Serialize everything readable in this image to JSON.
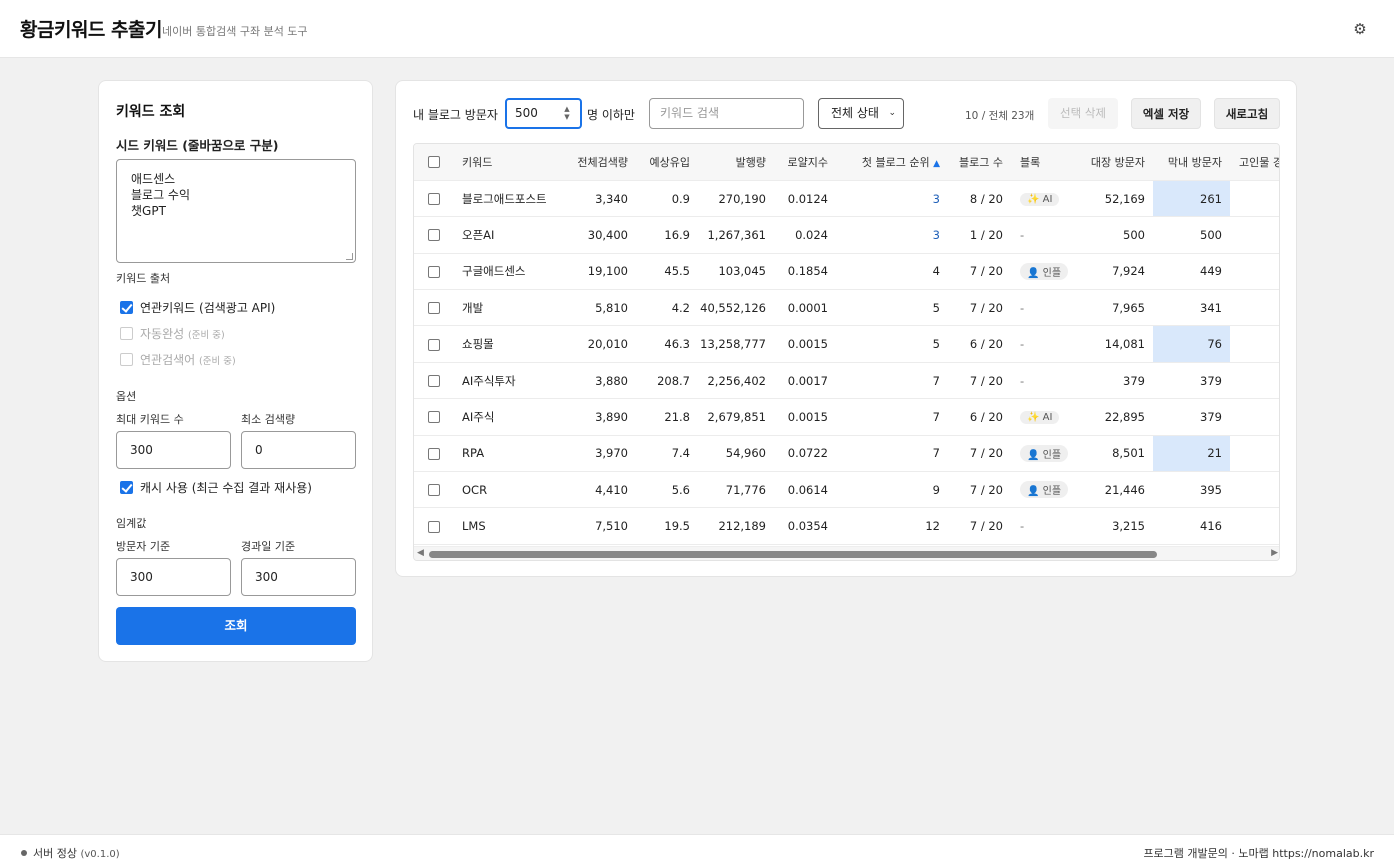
{
  "header": {
    "title": "황금키워드 추출기",
    "subtitle": "네이버 통합검색 구좌 분석 도구",
    "settings_icon": "gear-icon"
  },
  "left": {
    "title": "키워드 조회",
    "seed_label": "시드 키워드 (줄바꿈으로 구분)",
    "seed_lines": [
      "애드센스",
      "블로그 수익",
      "챗GPT"
    ],
    "source_label": "키워드 출처",
    "sources": [
      {
        "label": "연관키워드 (검색광고 API)",
        "note": "",
        "checked": true,
        "disabled": false
      },
      {
        "label": "자동완성",
        "note": "(준비 중)",
        "checked": false,
        "disabled": true
      },
      {
        "label": "연관검색어",
        "note": "(준비 중)",
        "checked": false,
        "disabled": true
      }
    ],
    "options_label": "옵션",
    "max_kw_label": "최대 키워드 수",
    "max_kw_value": "300",
    "min_search_label": "최소 검색량",
    "min_search_value": "0",
    "cache_label": "캐시 사용 (최근 수집 결과 재사용)",
    "cache_checked": true,
    "threshold_label": "임계값",
    "visitor_label": "방문자 기준",
    "visitor_value": "300",
    "days_label": "경과일 기준",
    "days_value": "300",
    "submit_label": "조회"
  },
  "toolbar": {
    "visitor_prefix": "내 블로그 방문자",
    "visitor_value": "500",
    "visitor_suffix": "명 이하만",
    "search_placeholder": "키워드 검색",
    "status_select": "전체 상태",
    "count_text": "10 / 전체 23개",
    "delete_label": "선택 삭제",
    "excel_label": "엑셀 저장",
    "refresh_label": "새로고침"
  },
  "table": {
    "headers": [
      "키워드",
      "전체검색량",
      "예상유입",
      "발행량",
      "로얄지수",
      "첫 블로그 순위",
      "블로그 수",
      "블록",
      "대장 방문자",
      "막내 방문자",
      "고인물 경"
    ],
    "rows": [
      {
        "kw": "블로그애드포스트",
        "total": "3,340",
        "expected": "0.9",
        "published": "270,190",
        "royal": "0.0124",
        "rank": "3",
        "rank_link": true,
        "blogs": "8 / 20",
        "block": "✨ AI",
        "block_badge": true,
        "leader": "52,169",
        "youngest": "261",
        "hl": true
      },
      {
        "kw": "오픈AI",
        "total": "30,400",
        "expected": "16.9",
        "published": "1,267,361",
        "royal": "0.024",
        "rank": "3",
        "rank_link": true,
        "blogs": "1 / 20",
        "block": "-",
        "block_badge": false,
        "leader": "500",
        "youngest": "500",
        "hl": false
      },
      {
        "kw": "구글애드센스",
        "total": "19,100",
        "expected": "45.5",
        "published": "103,045",
        "royal": "0.1854",
        "rank": "4",
        "rank_link": false,
        "blogs": "7 / 20",
        "block": "👤 인플",
        "block_badge": true,
        "leader": "7,924",
        "youngest": "449",
        "hl": false
      },
      {
        "kw": "개발",
        "total": "5,810",
        "expected": "4.2",
        "published": "40,552,126",
        "royal": "0.0001",
        "rank": "5",
        "rank_link": false,
        "blogs": "7 / 20",
        "block": "-",
        "block_badge": false,
        "leader": "7,965",
        "youngest": "341",
        "hl": false
      },
      {
        "kw": "쇼핑몰",
        "total": "20,010",
        "expected": "46.3",
        "published": "13,258,777",
        "royal": "0.0015",
        "rank": "5",
        "rank_link": false,
        "blogs": "6 / 20",
        "block": "-",
        "block_badge": false,
        "leader": "14,081",
        "youngest": "76",
        "hl": true
      },
      {
        "kw": "AI주식투자",
        "total": "3,880",
        "expected": "208.7",
        "published": "2,256,402",
        "royal": "0.0017",
        "rank": "7",
        "rank_link": false,
        "blogs": "7 / 20",
        "block": "-",
        "block_badge": false,
        "leader": "379",
        "youngest": "379",
        "hl": false
      },
      {
        "kw": "AI주식",
        "total": "3,890",
        "expected": "21.8",
        "published": "2,679,851",
        "royal": "0.0015",
        "rank": "7",
        "rank_link": false,
        "blogs": "6 / 20",
        "block": "✨ AI",
        "block_badge": true,
        "leader": "22,895",
        "youngest": "379",
        "hl": false
      },
      {
        "kw": "RPA",
        "total": "3,970",
        "expected": "7.4",
        "published": "54,960",
        "royal": "0.0722",
        "rank": "7",
        "rank_link": false,
        "blogs": "7 / 20",
        "block": "👤 인플",
        "block_badge": true,
        "leader": "8,501",
        "youngest": "21",
        "hl": true
      },
      {
        "kw": "OCR",
        "total": "4,410",
        "expected": "5.6",
        "published": "71,776",
        "royal": "0.0614",
        "rank": "9",
        "rank_link": false,
        "blogs": "7 / 20",
        "block": "👤 인플",
        "block_badge": true,
        "leader": "21,446",
        "youngest": "395",
        "hl": false
      },
      {
        "kw": "LMS",
        "total": "7,510",
        "expected": "19.5",
        "published": "212,189",
        "royal": "0.0354",
        "rank": "12",
        "rank_link": false,
        "blogs": "7 / 20",
        "block": "-",
        "block_badge": false,
        "leader": "3,215",
        "youngest": "416",
        "hl": false
      }
    ]
  },
  "footer": {
    "status": "서버 정상",
    "version": "(v0.1.0)",
    "credit": "프로그램 개발문의 · 노마랩 https://nomalab.kr"
  }
}
